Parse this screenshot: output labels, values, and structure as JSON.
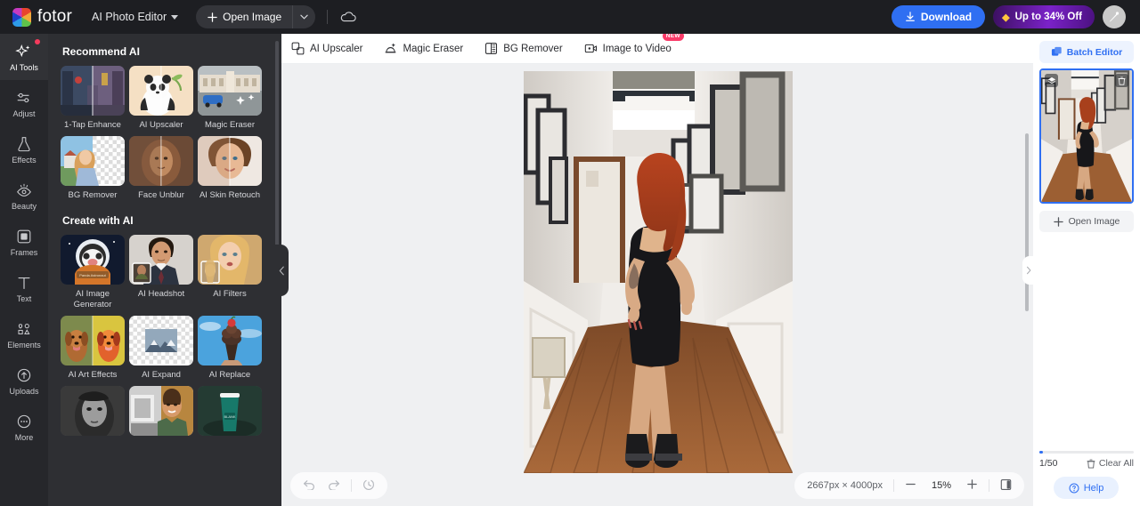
{
  "header": {
    "brand": "fotor",
    "brand_icon": "fotor-logo-icon",
    "app_title": "AI Photo Editor",
    "open_image_label": "Open Image",
    "plus_icon": "plus-icon",
    "caret_icon": "chevron-down-icon",
    "cloud_icon": "cloud-icon",
    "download_label": "Download",
    "download_icon": "download-icon",
    "promo_label": "Up to 34% Off",
    "promo_icon": "gem-icon",
    "avatar_icon": "user-avatar",
    "accent_blue": "#2f6ff2",
    "promo_purple": "#7b22c9",
    "header_bg": "#1d1e22"
  },
  "sidebar": {
    "items": [
      {
        "label": "AI Tools",
        "icon": "sparkles-icon",
        "active": true,
        "dot": true
      },
      {
        "label": "Adjust",
        "icon": "sliders-icon",
        "active": false,
        "dot": false
      },
      {
        "label": "Effects",
        "icon": "flask-icon",
        "active": false,
        "dot": false
      },
      {
        "label": "Beauty",
        "icon": "eye-icon",
        "active": false,
        "dot": false
      },
      {
        "label": "Frames",
        "icon": "frame-icon",
        "active": false,
        "dot": false
      },
      {
        "label": "Text",
        "icon": "text-t-icon",
        "active": false,
        "dot": false
      },
      {
        "label": "Elements",
        "icon": "shapes-icon",
        "active": false,
        "dot": false
      },
      {
        "label": "Uploads",
        "icon": "upload-cloud-icon",
        "active": false,
        "dot": false
      },
      {
        "label": "More",
        "icon": "ellipsis-circle-icon",
        "active": false,
        "dot": false
      }
    ]
  },
  "panel": {
    "sections": [
      {
        "title": "Recommend AI",
        "cards": [
          {
            "label": "1-Tap Enhance",
            "thumb": "street-night-split"
          },
          {
            "label": "AI Upscaler",
            "thumb": "panda-split"
          },
          {
            "label": "Magic Eraser",
            "thumb": "building-car-erase"
          },
          {
            "label": "BG Remover",
            "thumb": "woman-bg-checker"
          },
          {
            "label": "Face Unblur",
            "thumb": "curly-hair-face-split"
          },
          {
            "label": "AI Skin Retouch",
            "thumb": "skin-retouch-split"
          }
        ]
      },
      {
        "title": "Create with AI",
        "cards": [
          {
            "label": "AI Image Generator",
            "thumb": "panda-astronaut"
          },
          {
            "label": "AI Headshot",
            "thumb": "man-suit-headshot"
          },
          {
            "label": "AI Filters",
            "thumb": "blonde-woman-filter"
          },
          {
            "label": "AI Art Effects",
            "thumb": "dog-art-split"
          },
          {
            "label": "AI Expand",
            "thumb": "mountain-expand-checker"
          },
          {
            "label": "AI Replace",
            "thumb": "icecream-sky"
          },
          {
            "label": "",
            "thumb": "bw-portrait"
          },
          {
            "label": "",
            "thumb": "colorize-man"
          },
          {
            "label": "",
            "thumb": "coffee-cup-green"
          }
        ]
      }
    ],
    "collapse_icon": "chevron-left-icon"
  },
  "toolbar": {
    "tabs": [
      {
        "label": "AI Upscaler",
        "icon": "upscale-icon",
        "badge": ""
      },
      {
        "label": "Magic Eraser",
        "icon": "magic-eraser-icon",
        "badge": ""
      },
      {
        "label": "BG Remover",
        "icon": "bg-remover-icon",
        "badge": ""
      },
      {
        "label": "Image to Video",
        "icon": "video-icon",
        "badge": "NEW"
      }
    ]
  },
  "canvas": {
    "bg_color": "#eff0f2",
    "image_alt": "woman-in-black-dress-hallway"
  },
  "statusbar": {
    "undo_icon": "undo-icon",
    "redo_icon": "redo-icon",
    "history_icon": "history-clock-icon",
    "dimensions": "2667px × 4000px",
    "zoom_out_icon": "minus-icon",
    "zoom_level": "15%",
    "zoom_in_icon": "plus-icon",
    "fit_icon": "fit-panel-icon"
  },
  "rightpanel": {
    "batch_editor_label": "Batch Editor",
    "batch_editor_icon": "batch-layers-icon",
    "thumb_layers_icon": "layers-icon",
    "thumb_delete_icon": "trash-icon",
    "open_image_label": "Open Image",
    "open_image_icon": "plus-icon",
    "count_label": "1/50",
    "clear_all_label": "Clear All",
    "clear_all_icon": "trash-icon",
    "help_label": "Help",
    "help_icon": "question-circle-icon",
    "expand_icon": "chevron-right-icon"
  }
}
